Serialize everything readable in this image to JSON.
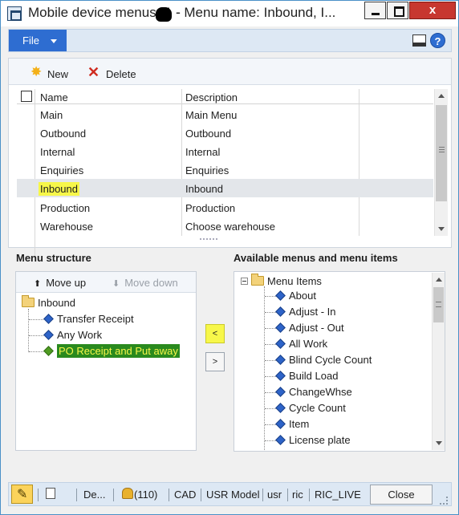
{
  "window": {
    "title": "Mobile device menus (1 - ",
    "title_rest": " - Menu name: Inbound, I...",
    "close_glyph": "x"
  },
  "ribbon": {
    "file_label": "File",
    "help_glyph": "?"
  },
  "toolbar": {
    "new_label": "New",
    "delete_label": "Delete"
  },
  "grid": {
    "columns": [
      "Name",
      "Description"
    ],
    "rows": [
      {
        "name": "Main",
        "description": "Main Menu"
      },
      {
        "name": "Outbound",
        "description": "Outbound"
      },
      {
        "name": "Internal",
        "description": "Internal"
      },
      {
        "name": "Enquiries",
        "description": "Enquiries"
      },
      {
        "name": "Inbound",
        "description": "Inbound"
      },
      {
        "name": "Production",
        "description": "Production"
      },
      {
        "name": "Warehouse",
        "description": "Choose warehouse"
      }
    ]
  },
  "menu_structure": {
    "title": "Menu structure",
    "move_up": "Move up",
    "move_down": "Move down",
    "root": "Inbound",
    "items": [
      "Transfer Receipt",
      "Any Work",
      "PO Receipt and Put away"
    ]
  },
  "transfer": {
    "left_glyph": "<",
    "right_glyph": ">"
  },
  "available": {
    "title": "Available menus and menu items",
    "root": "Menu Items",
    "items": [
      "About",
      "Adjust - In",
      "Adjust - Out",
      "All Work",
      "Blind Cycle Count",
      "Build Load",
      "ChangeWhse",
      "Cycle Count",
      "Item",
      "License plate"
    ]
  },
  "statusbar": {
    "doc_label": "De...",
    "notifications": "(110)",
    "currency": "CAD",
    "model": "USR Model",
    "user": "usr",
    "company": "ric",
    "environment": "RIC_LIVE",
    "close_label": "Close"
  },
  "colors": {
    "highlight": "#f7f74a",
    "accent": "#2e6dd1",
    "close_red": "#c7372f"
  }
}
